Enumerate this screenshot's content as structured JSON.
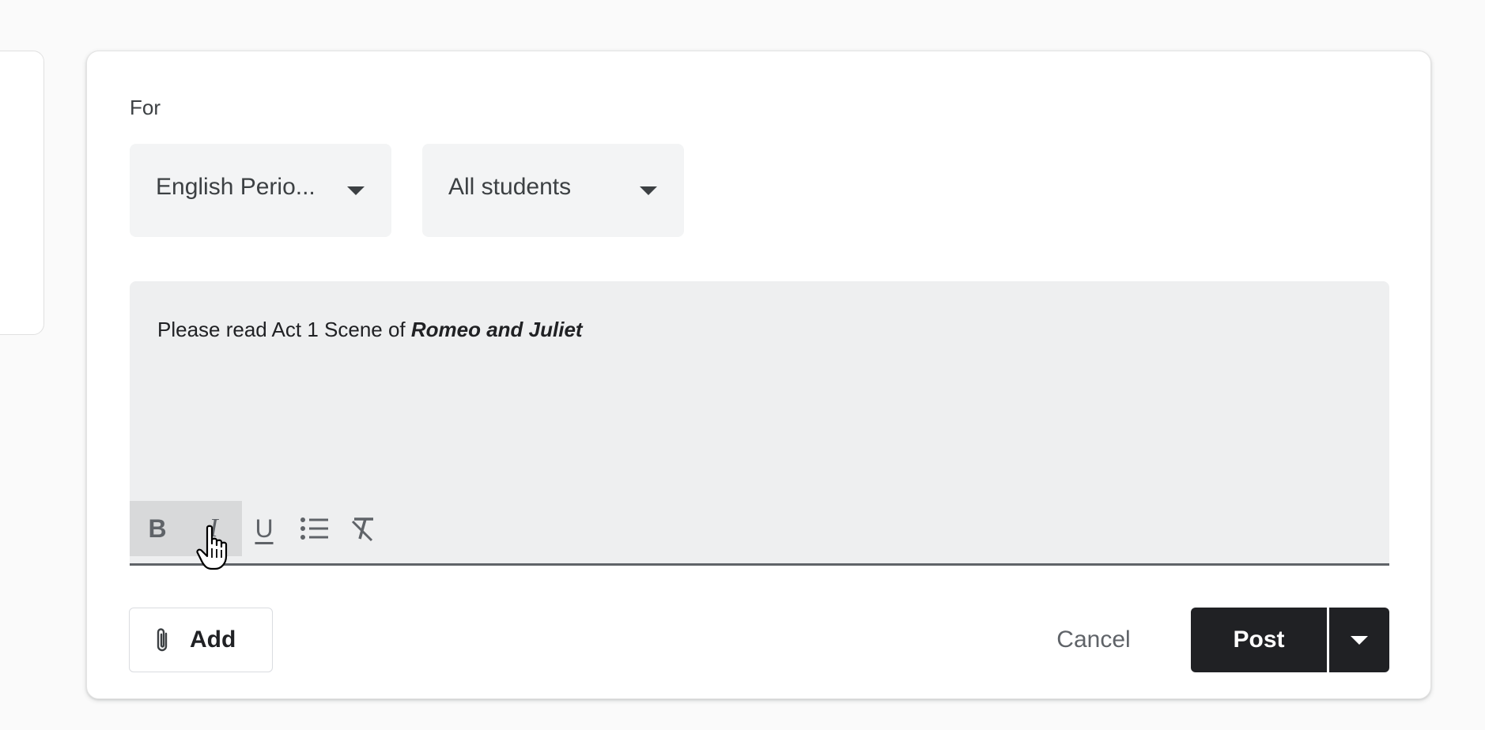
{
  "for_label": "For",
  "class_select": {
    "value": "English Perio..."
  },
  "students_select": {
    "value": "All students"
  },
  "editor": {
    "text_plain": "Please read Act 1 Scene of ",
    "text_emphasis": "Romeo and Juliet"
  },
  "toolbar": {
    "bold_label": "B",
    "italic_label": "I",
    "underline_label": "U"
  },
  "actions": {
    "add_label": "Add",
    "cancel_label": "Cancel",
    "post_label": "Post"
  },
  "icons": {
    "attach": "paperclip-icon",
    "list": "bulleted-list-icon",
    "clear": "clear-formatting-icon",
    "dropdown": "caret-down-icon",
    "cursor": "hand-pointer-cursor-icon"
  },
  "colors": {
    "post_button_bg": "#202124",
    "editor_bg": "#eeeff0",
    "select_bg": "#f3f4f5"
  }
}
